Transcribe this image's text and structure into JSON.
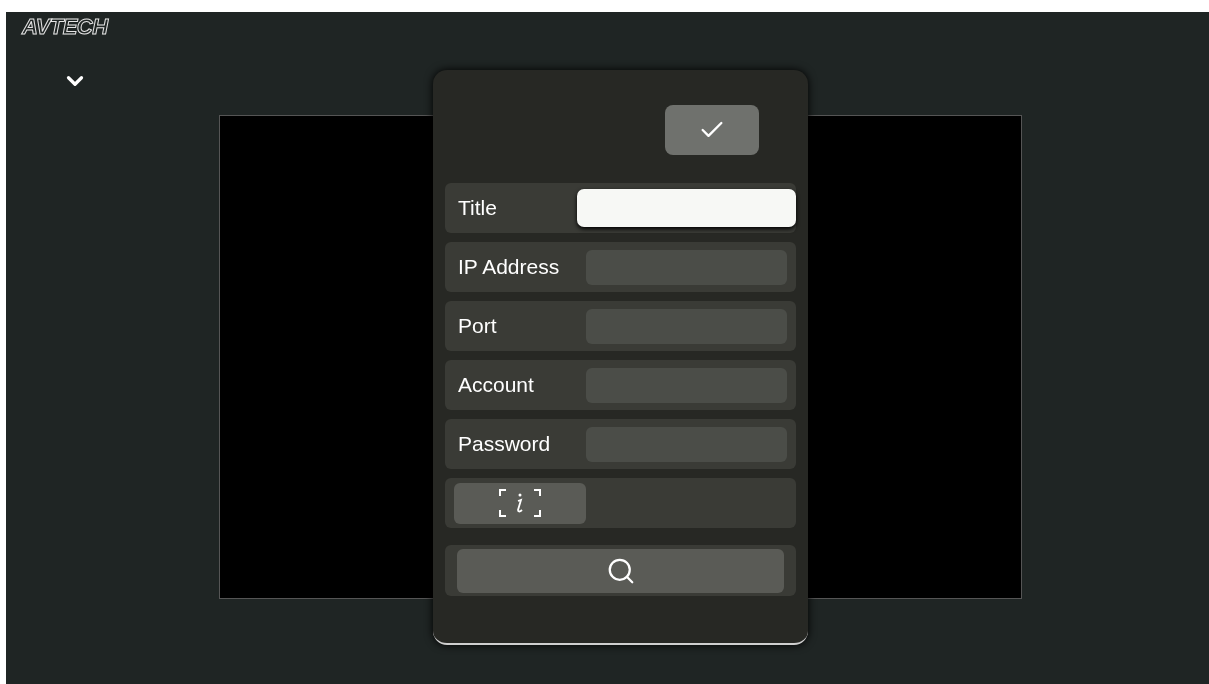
{
  "logo": "AVTECH",
  "dialog": {
    "fields": [
      {
        "label": "Title",
        "selected": true
      },
      {
        "label": "IP Address",
        "selected": false
      },
      {
        "label": "Port",
        "selected": false
      },
      {
        "label": "Account",
        "selected": false
      },
      {
        "label": "Password",
        "selected": false
      }
    ]
  }
}
